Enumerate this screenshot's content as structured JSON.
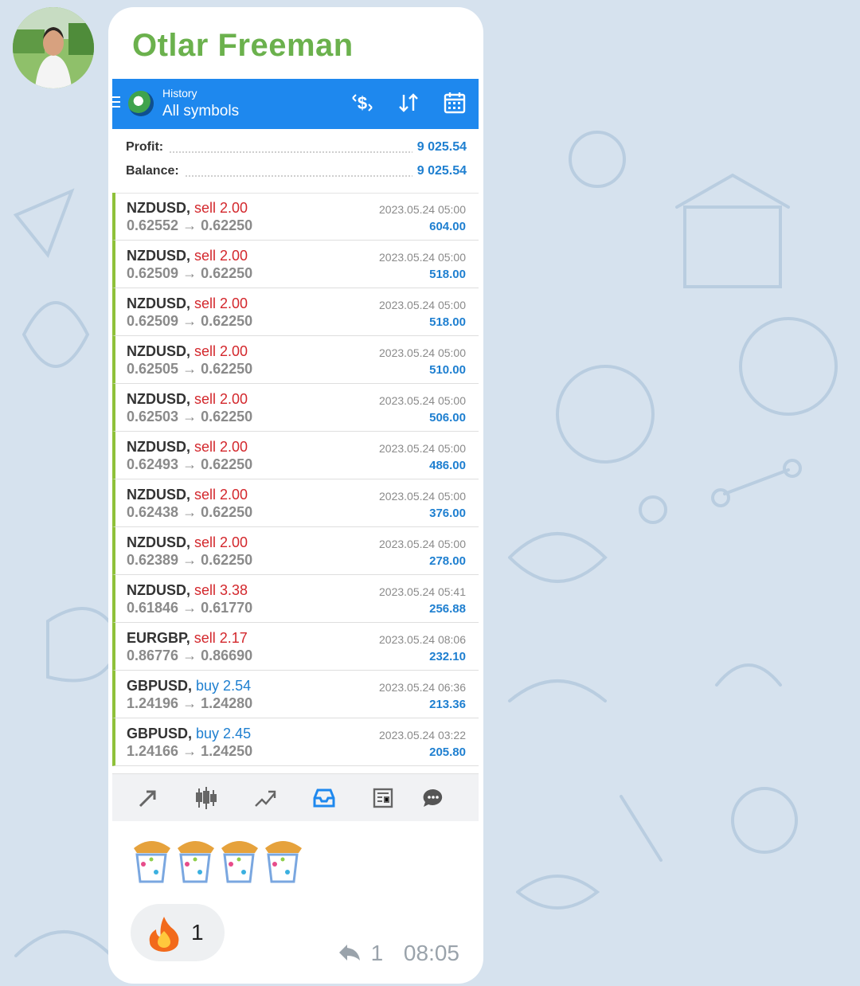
{
  "message": {
    "sender_name": "Otlar Freeman",
    "reaction": {
      "icon": "fire-emoji",
      "count": "1"
    },
    "emoji_icon": "party-popper-emoji",
    "meta": {
      "reply_icon": "reply-arrow-icon",
      "reply_count": "1",
      "time": "08:05"
    }
  },
  "app": {
    "subtitle": "History",
    "title": "All symbols",
    "toolbar_icons": [
      "dollar-arrows-icon",
      "sort-icon",
      "calendar-icon"
    ],
    "summary": {
      "profit_label": "Profit:",
      "profit_value": "9 025.54",
      "balance_label": "Balance:",
      "balance_value": "9 025.54"
    },
    "deals": [
      {
        "symbol": "NZDUSD,",
        "side": "sell 2.00",
        "type": "sell",
        "prices": "0.62552 → 0.62250",
        "time": "2023.05.24 05:00",
        "profit": "604.00"
      },
      {
        "symbol": "NZDUSD,",
        "side": "sell 2.00",
        "type": "sell",
        "prices": "0.62509 → 0.62250",
        "time": "2023.05.24 05:00",
        "profit": "518.00"
      },
      {
        "symbol": "NZDUSD,",
        "side": "sell 2.00",
        "type": "sell",
        "prices": "0.62509 → 0.62250",
        "time": "2023.05.24 05:00",
        "profit": "518.00"
      },
      {
        "symbol": "NZDUSD,",
        "side": "sell 2.00",
        "type": "sell",
        "prices": "0.62505 → 0.62250",
        "time": "2023.05.24 05:00",
        "profit": "510.00"
      },
      {
        "symbol": "NZDUSD,",
        "side": "sell 2.00",
        "type": "sell",
        "prices": "0.62503 → 0.62250",
        "time": "2023.05.24 05:00",
        "profit": "506.00"
      },
      {
        "symbol": "NZDUSD,",
        "side": "sell 2.00",
        "type": "sell",
        "prices": "0.62493 → 0.62250",
        "time": "2023.05.24 05:00",
        "profit": "486.00"
      },
      {
        "symbol": "NZDUSD,",
        "side": "sell 2.00",
        "type": "sell",
        "prices": "0.62438 → 0.62250",
        "time": "2023.05.24 05:00",
        "profit": "376.00"
      },
      {
        "symbol": "NZDUSD,",
        "side": "sell 2.00",
        "type": "sell",
        "prices": "0.62389 → 0.62250",
        "time": "2023.05.24 05:00",
        "profit": "278.00"
      },
      {
        "symbol": "NZDUSD,",
        "side": "sell 3.38",
        "type": "sell",
        "prices": "0.61846 → 0.61770",
        "time": "2023.05.24 05:41",
        "profit": "256.88"
      },
      {
        "symbol": "EURGBP,",
        "side": "sell 2.17",
        "type": "sell",
        "prices": "0.86776 → 0.86690",
        "time": "2023.05.24 08:06",
        "profit": "232.10"
      },
      {
        "symbol": "GBPUSD,",
        "side": "buy 2.54",
        "type": "buy",
        "prices": "1.24196 → 1.24280",
        "time": "2023.05.24 06:36",
        "profit": "213.36"
      },
      {
        "symbol": "GBPUSD,",
        "side": "buy 2.45",
        "type": "buy",
        "prices": "1.24166 → 1.24250",
        "time": "2023.05.24 03:22",
        "profit": "205.80"
      }
    ],
    "bottom_nav": [
      "trade-icon",
      "chart-candles-icon",
      "trend-icon",
      "history-inbox-icon",
      "news-icon",
      "chat-icon"
    ],
    "colors": {
      "appbar": "#1e88ee",
      "profit": "#1e7fd0",
      "sell": "#d3272c",
      "buy": "#1e7fd0",
      "accent_bar": "#8fc13a",
      "sender": "#6bb14d"
    }
  }
}
